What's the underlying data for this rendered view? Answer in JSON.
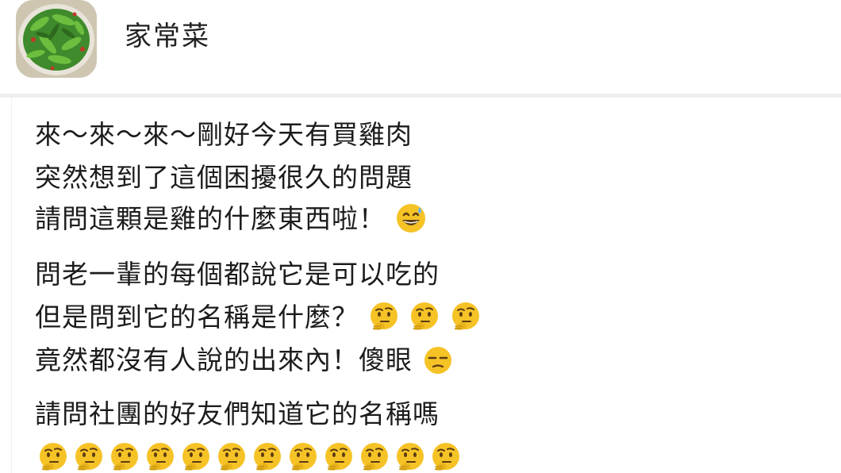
{
  "header": {
    "group_name": "家常菜",
    "avatar_icon": "green-vegetable-dish-photo"
  },
  "post": {
    "paragraph1": [
      "來～來～來～剛好今天有買雞肉",
      "突然想到了這個困擾很久的問題",
      "請問這顆是雞的什麼東西啦！"
    ],
    "paragraph1_end_emoji": "grinning-sweat-emoji",
    "paragraph2": [
      "問老一輩的每個都說它是可以吃的",
      "但是問到它的名稱是什麼？",
      "竟然都沒有人說的出來內！傻眼"
    ],
    "paragraph2_line2_emojis": [
      "thinking-face-emoji",
      "thinking-face-emoji",
      "thinking-face-emoji"
    ],
    "paragraph2_line3_emoji": "unamused-face-emoji",
    "paragraph3": [
      "請問社團的好友們知道它的名稱嗎"
    ],
    "final_emoji_row": "thinking-face-emoji",
    "final_emoji_count": 12
  },
  "colors": {
    "text": "#1c1c1c",
    "divider": "#eeeff1",
    "emoji_yellow": "#f6c327"
  }
}
